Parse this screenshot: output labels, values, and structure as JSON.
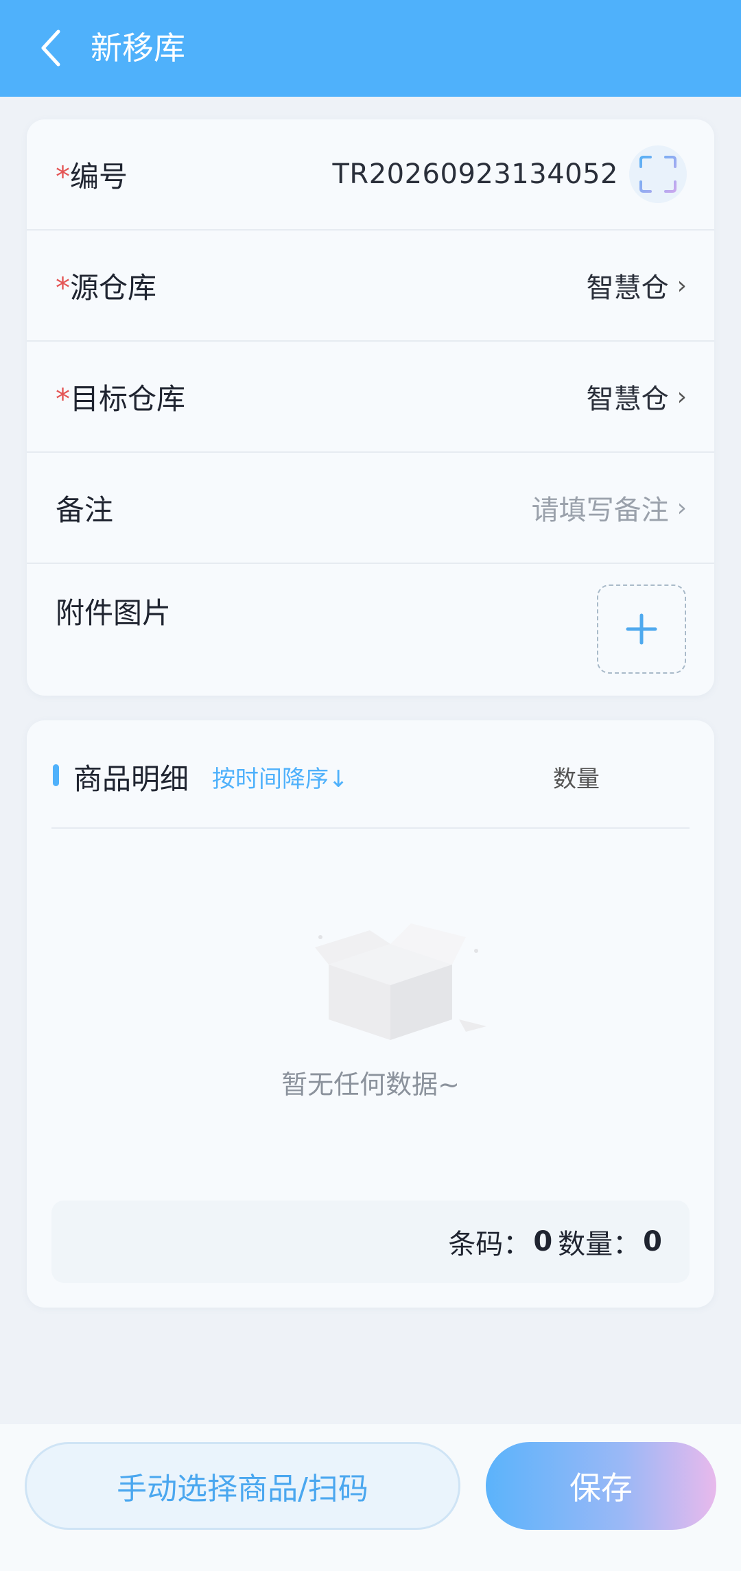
{
  "header": {
    "title": "新移库",
    "back_icon": "chevron-left-icon"
  },
  "form": {
    "code": {
      "required_mark": "*",
      "label": "编号",
      "value": "TR20260923134052",
      "scan_icon": "scan-icon"
    },
    "source_warehouse": {
      "required_mark": "*",
      "label": "源仓库",
      "value": "智慧仓",
      "arrow": "›"
    },
    "target_warehouse": {
      "required_mark": "*",
      "label": "目标仓库",
      "value": "智慧仓",
      "arrow": "›"
    },
    "remark": {
      "label": "备注",
      "placeholder": "请填写备注",
      "arrow": "›"
    },
    "attachment": {
      "label": "附件图片",
      "add_icon": "plus-icon"
    }
  },
  "items": {
    "title": "商品明细",
    "sort_label": "按时间降序↓",
    "qty_column": "数量",
    "empty_text": "暂无任何数据~",
    "summary": {
      "barcode_label": "条码：",
      "barcode_count": "0",
      "qty_label": "数量：",
      "qty_count": "0"
    }
  },
  "bottom": {
    "manual_button": "手动选择商品/扫码",
    "save_button": "保存"
  },
  "colors": {
    "header": "#4fb1fb",
    "accent": "#4fb1fb",
    "required": "#e45555"
  }
}
